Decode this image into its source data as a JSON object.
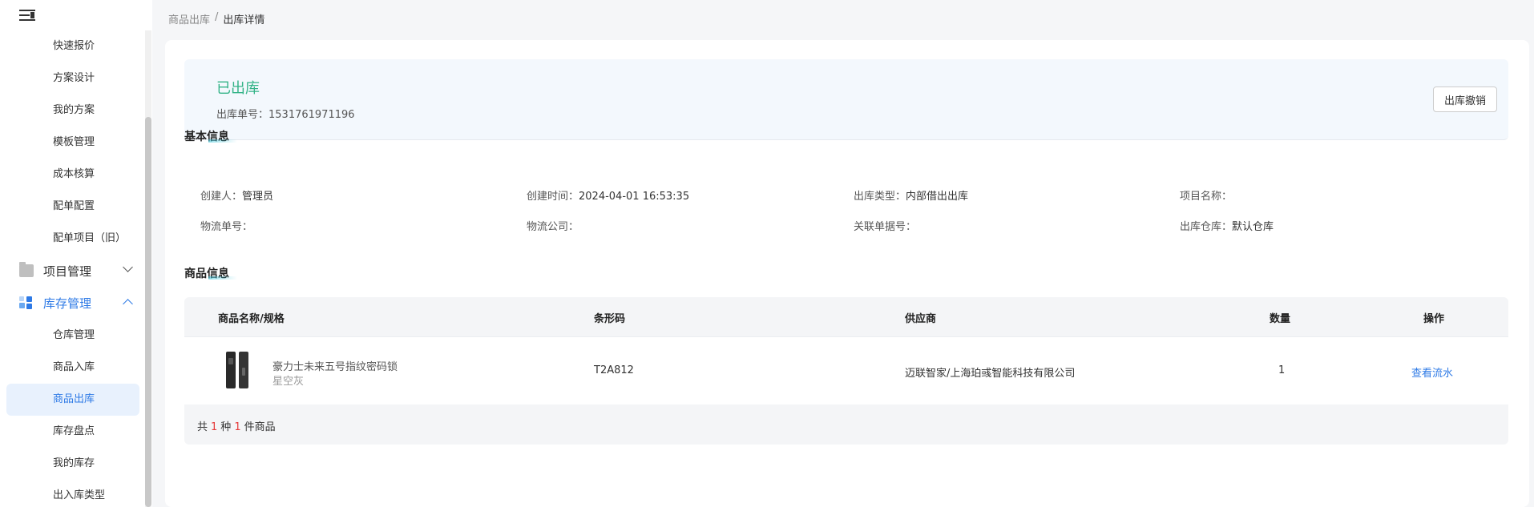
{
  "sidebar": {
    "top_items": [
      "快速报价",
      "方案设计",
      "我的方案",
      "模板管理",
      "成本核算",
      "配单配置",
      "配单项目（旧）"
    ],
    "groups": [
      {
        "label": "项目管理",
        "icon": "folder-icon",
        "expanded": false
      },
      {
        "label": "库存管理",
        "icon": "blocks-icon",
        "expanded": true
      }
    ],
    "stock_items": [
      "仓库管理",
      "商品入库",
      "商品出库",
      "库存盘点",
      "我的库存",
      "出入库类型"
    ],
    "active_item": "商品出库",
    "colors": {
      "active_text": "#2e7ae6",
      "active_bg": "#e8f1fd"
    }
  },
  "breadcrumb": {
    "parent": "商品出库",
    "separator": "/",
    "current": "出库详情"
  },
  "status": {
    "title": "已出库",
    "order_no_label": "出库单号：",
    "order_no": "1531761971196",
    "revoke_label": "出库撤销",
    "color": "#33b387"
  },
  "basic_info": {
    "title": "基本信息",
    "creator_label": "创建人：",
    "creator": "管理员",
    "created_time_label": "创建时间：",
    "created_time": "2024-04-01 16:53:35",
    "outbound_type_label": "出库类型：",
    "outbound_type": "内部借出出库",
    "project_name_label": "项目名称：",
    "project_name": "",
    "logistics_no_label": "物流单号：",
    "logistics_no": "",
    "logistics_company_label": "物流公司：",
    "logistics_company": "",
    "related_doc_label": "关联单据号：",
    "related_doc": "",
    "warehouse_label": "出库仓库：",
    "warehouse": "默认仓库"
  },
  "goods": {
    "title": "商品信息",
    "columns": [
      "商品名称/规格",
      "条形码",
      "供应商",
      "数量",
      "操作"
    ],
    "rows": [
      {
        "name": "豪力士未来五号指纹密码锁",
        "spec": "星空灰",
        "barcode": "T2A812",
        "supplier": "迈联智家/上海珀彧智能科技有限公司",
        "quantity": "1",
        "action": "查看流水"
      }
    ],
    "summary": {
      "prefix": "共",
      "kinds": "1",
      "mid": "种",
      "count": "1",
      "suffix": "件商品"
    }
  }
}
